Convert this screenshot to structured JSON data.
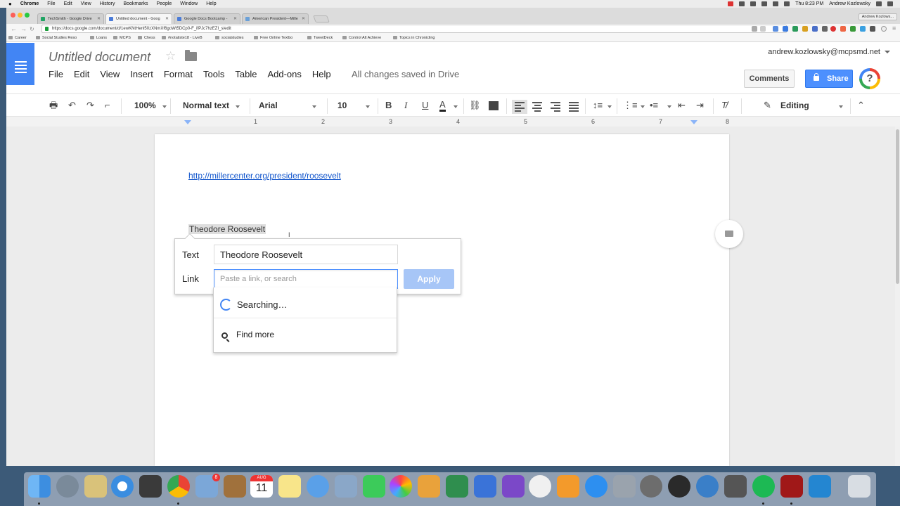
{
  "mac_menubar": {
    "apple": "",
    "items": [
      "Chrome",
      "File",
      "Edit",
      "View",
      "History",
      "Bookmarks",
      "People",
      "Window",
      "Help"
    ],
    "clock": "Thu 8:23 PM",
    "user": "Andrew Kozlowsky"
  },
  "browser": {
    "tabs": [
      {
        "label": "TechSmith - Google Drive"
      },
      {
        "label": "Untitled document - Goog"
      },
      {
        "label": "Google Docs Bootcamp -"
      },
      {
        "label": "American President—Mille"
      }
    ],
    "profile": "Andrew Kozlows...",
    "url": "https://docs.google.com/document/d/1ewKNtHenl50zXNmXf6goWt5DCp0-F_ifPJc7hzEZI_s/edit",
    "bookmarks": [
      "Career",
      "Social Studies Reso",
      "Loans",
      "MCPS",
      "Chess",
      "#notatiste18 - LiveB",
      "socialstudies",
      "Free Online Textbo",
      "TweetDeck",
      "Control Alt Achieve",
      "Topics in Chronicling"
    ]
  },
  "docs": {
    "title": "Untitled document",
    "menu": [
      "File",
      "Edit",
      "View",
      "Insert",
      "Format",
      "Tools",
      "Table",
      "Add-ons",
      "Help"
    ],
    "save_status": "All changes saved in Drive",
    "account": "andrew.kozlowsky@mcpsmd.net",
    "comments_label": "Comments",
    "share_label": "Share",
    "help_label": "?"
  },
  "toolbar": {
    "zoom": "100%",
    "style": "Normal text",
    "font": "Arial",
    "size": "10",
    "bold": "B",
    "italic": "I",
    "underline": "U",
    "text_color": "A",
    "mode": "Editing"
  },
  "ruler": {
    "numbers": [
      "1",
      "2",
      "3",
      "4",
      "5",
      "6",
      "7",
      "8"
    ]
  },
  "document": {
    "link_text": "http://millercenter.org/president/roosevelt",
    "selected_text": "Theodore Roosevelt"
  },
  "link_popup": {
    "text_label": "Text",
    "text_value": "Theodore Roosevelt",
    "link_label": "Link",
    "link_placeholder": "Paste a link, or search",
    "apply_label": "Apply",
    "searching_label": "Searching…",
    "find_more_label": "Find more"
  },
  "dock": {
    "calendar_month": "AUG",
    "calendar_day": "11",
    "mail_badge": "8"
  },
  "colors": {
    "docs_blue": "#4285f4",
    "link_blue": "#1155cc",
    "share_blue": "#4d90fe",
    "apply_disabled": "#a7c6f7"
  }
}
